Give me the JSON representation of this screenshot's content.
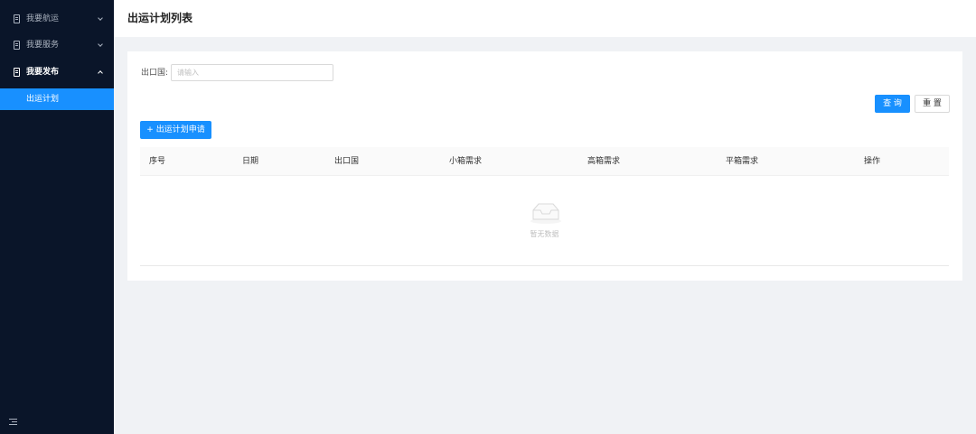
{
  "sidebar": {
    "menus": [
      {
        "label": "我要航运",
        "icon": "document-icon",
        "expanded": false
      },
      {
        "label": "我要服务",
        "icon": "document-icon",
        "expanded": false
      },
      {
        "label": "我要发布",
        "icon": "document-icon",
        "expanded": true
      }
    ],
    "submenu": {
      "label": "出运计划",
      "active": true
    },
    "collapse_icon": "menu-fold-icon"
  },
  "header": {
    "title": "出运计划列表"
  },
  "search": {
    "label": "出口国:",
    "placeholder": "请输入",
    "value": ""
  },
  "buttons": {
    "query": "查 询",
    "reset": "重 置",
    "apply": "+ 出运计划申请"
  },
  "table": {
    "columns": [
      "序号",
      "日期",
      "出口国",
      "小箱需求",
      "高箱需求",
      "平箱需求",
      "操作"
    ],
    "rows": [],
    "empty_text": "暂无数据",
    "empty_icon": "empty-inbox-icon"
  },
  "colors": {
    "primary": "#1890ff",
    "sidebar_bg": "#0a1529",
    "page_bg": "#f0f2f5"
  }
}
